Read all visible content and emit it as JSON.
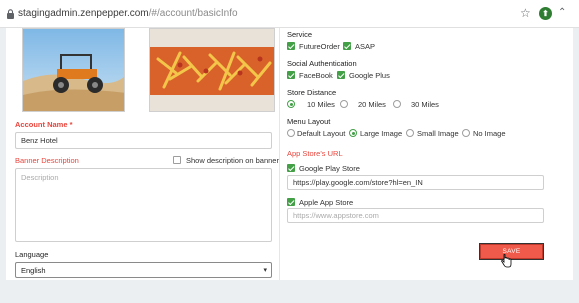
{
  "browser": {
    "url_host": "stagingadmin.zenpepper.com",
    "url_path": "/#/account/basicInfo",
    "icons": [
      "lock-icon",
      "star-icon",
      "extension-icon",
      "chevron-up-icon"
    ]
  },
  "left": {
    "account_name_label": "Account Name *",
    "account_name_value": "Benz Hotel",
    "banner_description_label": "Banner Description",
    "show_description_label": "Show description on banner",
    "show_description_checked": false,
    "description_placeholder": "Description",
    "language_label": "Language",
    "language_selected": "English"
  },
  "right": {
    "service_label": "Service",
    "service_options": [
      {
        "label": "FutureOrder",
        "checked": true
      },
      {
        "label": "ASAP",
        "checked": true
      }
    ],
    "social_auth_label": "Social Authentication",
    "social_options": [
      {
        "label": "FaceBook",
        "checked": true
      },
      {
        "label": "Google Plus",
        "checked": true
      }
    ],
    "store_distance_label": "Store Distance",
    "distance_options": [
      {
        "label": "10 Miles",
        "selected": true
      },
      {
        "label": "20 Miles",
        "selected": false
      },
      {
        "label": "30 Miles",
        "selected": false
      }
    ],
    "menu_layout_label": "Menu Layout",
    "layout_options": [
      {
        "label": "Default Layout",
        "selected": false
      },
      {
        "label": "Large Image",
        "selected": true
      },
      {
        "label": "Small Image",
        "selected": false
      },
      {
        "label": "No Image",
        "selected": false
      }
    ],
    "app_store_url_label": "App Store's URL",
    "google_play_label": "Google Play Store",
    "google_play_checked": true,
    "google_play_value": "https://play.google.com/store?hl=en_IN",
    "apple_store_label": "Apple App Store",
    "apple_store_checked": true,
    "apple_store_placeholder": "https://www.appstore.com",
    "save_label": "SAVE"
  },
  "colors": {
    "accent_red": "#e8453c",
    "check_green": "#43a047",
    "save_button": "#f05a4a"
  }
}
